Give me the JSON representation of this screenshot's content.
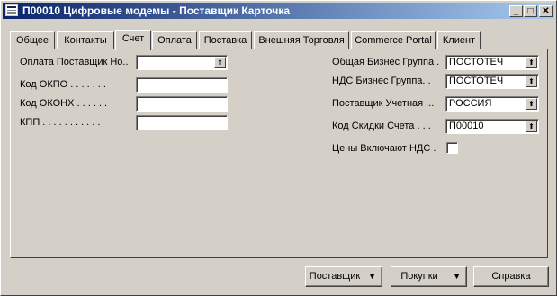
{
  "window": {
    "title": "П00010 Цифровые модемы - Поставщик Карточка",
    "minimize_glyph": "_",
    "maximize_glyph": "□",
    "close_glyph": "✕"
  },
  "tabs": [
    {
      "label": "Общее"
    },
    {
      "label": "Контакты"
    },
    {
      "label": "Счет"
    },
    {
      "label": "Оплата"
    },
    {
      "label": "Поставка"
    },
    {
      "label": "Внешняя Торговля"
    },
    {
      "label": "Commerce Portal"
    },
    {
      "label": "Клиент"
    }
  ],
  "active_tab": "Счет",
  "left_fields": [
    {
      "label": "Оплата Поставщик Но..",
      "value": "",
      "has_dropdown": true
    },
    {
      "label": "Код ОКПО . . . . . . .",
      "value": "",
      "has_dropdown": false
    },
    {
      "label": "Код ОКОНХ . . . . . .",
      "value": "",
      "has_dropdown": false
    },
    {
      "label": "КПП . . . . . . . . . . .",
      "value": "",
      "has_dropdown": false
    }
  ],
  "right_fields": [
    {
      "label": "Общая Бизнес Группа .",
      "value": "ПОСТОТЕЧ",
      "has_dropdown": true
    },
    {
      "label": "НДС Бизнес Группа. .",
      "value": "ПОСТОТЕЧ",
      "has_dropdown": true
    },
    {
      "label": "Поставщик Учетная ...",
      "value": "РОССИЯ",
      "has_dropdown": true
    },
    {
      "label": "Код Скидки Счета . . .",
      "value": "П00010",
      "has_dropdown": true
    }
  ],
  "prices_incl_vat": {
    "label": "Цены Включают НДС .",
    "checked": false
  },
  "dropdown_glyph": "⬆",
  "buttons": {
    "vendor": "Поставщик",
    "purchases": "Покупки",
    "help": "Справка",
    "menu_arrow": "▼"
  },
  "colors": {
    "face": "#d4d0c8",
    "title_start": "#0a246a",
    "title_end": "#a6caf0"
  }
}
